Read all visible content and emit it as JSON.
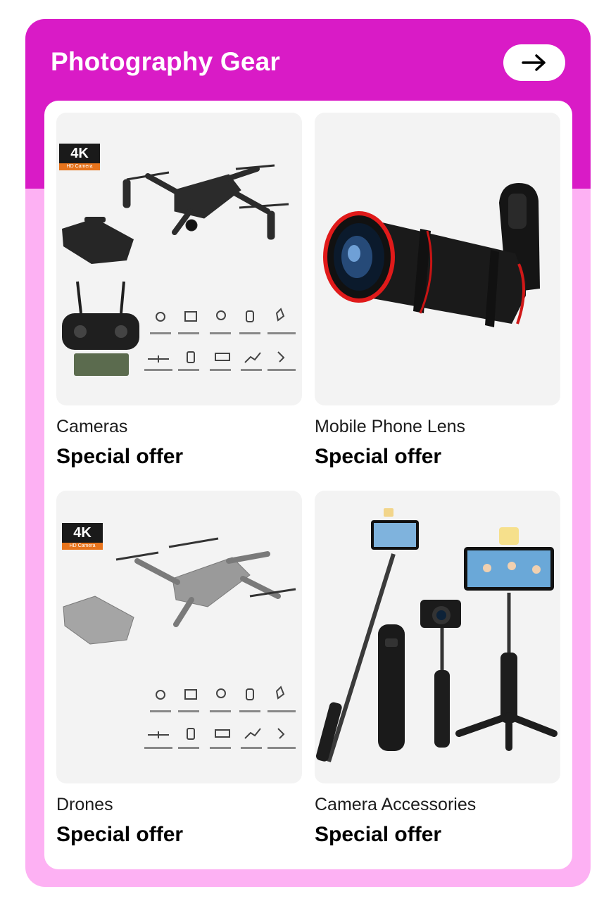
{
  "section": {
    "title": "Photography Gear",
    "arrow_icon": "arrow-right-icon"
  },
  "colors": {
    "header_bg": "#d91bc6",
    "card_bg": "#fdb1f3",
    "tile_bg": "#f3f3f3"
  },
  "tiles": [
    {
      "name": "Cameras",
      "offer": "Special offer",
      "badge": "4K",
      "badge_sub": "HD Camera",
      "image": "drone-with-controller"
    },
    {
      "name": "Mobile Phone Lens",
      "offer": "Special offer",
      "image": "telephoto-clip-lens"
    },
    {
      "name": "Drones",
      "offer": "Special offer",
      "badge": "4K",
      "badge_sub": "HD Camera",
      "image": "grey-drone"
    },
    {
      "name": "Camera Accessories",
      "offer": "Special offer",
      "image": "selfie-stick-tripods"
    }
  ]
}
